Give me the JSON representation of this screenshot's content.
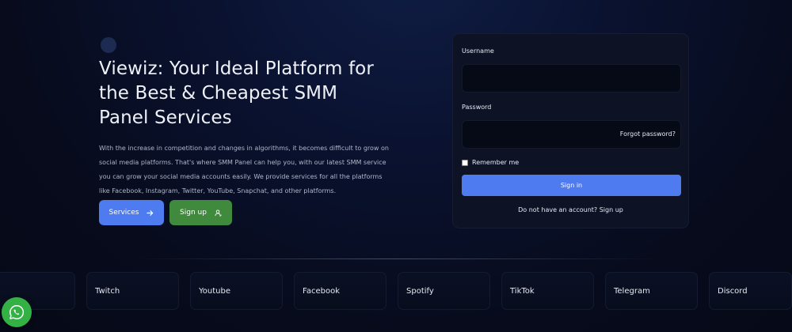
{
  "hero": {
    "title": "Viewiz: Your Ideal Platform for the Best & Cheapest SMM Panel Services",
    "description": "With the increase in competition and changes in algorithms, it becomes difficult to grow on social media platforms. That's where SMM Panel can help you, with our latest SMM service you can grow your social media accounts easily. We provide services for all the platforms like Facebook, Instagram, Twitter, YouTube, Snapchat, and other platforms.",
    "services_label": "Services",
    "signup_label": "Sign up"
  },
  "login": {
    "username_label": "Username",
    "password_label": "Password",
    "forgot_label": "Forgot password?",
    "remember_label": "Remember me",
    "signin_label": "Sign in",
    "no_account_label": "Do not have an account? Sign up"
  },
  "platforms": [
    "",
    "Twitch",
    "Youtube",
    "Facebook",
    "Spotify",
    "TikTok",
    "Telegram",
    "Discord"
  ],
  "colors": {
    "accent": "#4f7bf0",
    "signup_green": "#3f8a3c",
    "whatsapp_green": "#34b145"
  },
  "icons": {
    "services_button": "arrow-right-icon",
    "signup_button": "user-icon",
    "floating_button": "whatsapp-icon"
  }
}
